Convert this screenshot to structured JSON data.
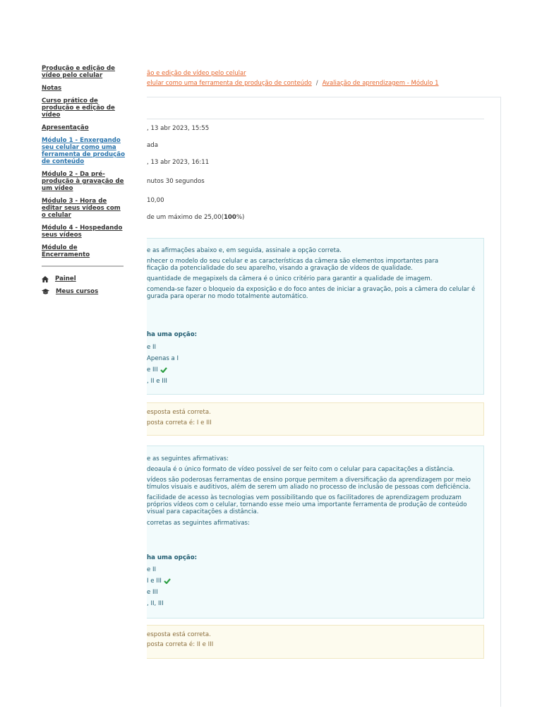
{
  "sidebar": {
    "items": [
      {
        "label": "Produção e edição de vídeo pelo celular",
        "active": false
      },
      {
        "label": "Notas",
        "active": false
      },
      {
        "label": "Curso prático de produção e edição de vídeo",
        "active": false
      },
      {
        "label": "Apresentação",
        "active": false
      },
      {
        "label": "Módulo 1 - Enxergando seu celular como uma ferramenta de produção de conteúdo",
        "active": true
      },
      {
        "label": "Módulo 2 - Da pré-produção à gravação de um vídeo",
        "active": false
      },
      {
        "label": "Módulo 3 - Hora de editar seus vídeos com o celular",
        "active": false
      },
      {
        "label": "Módulo 4 - Hospedando seus vídeos",
        "active": false
      },
      {
        "label": "Módulo de Encerramento",
        "active": false
      }
    ],
    "painel": "Painel",
    "meus_cursos": "Meus cursos"
  },
  "breadcrumb": {
    "line1": "ão e edição de vídeo pelo celular",
    "line2a": "elular como uma ferramenta de produção de conteúdo",
    "separator": "/",
    "line2b": "Avaliação de aprendizagem - Módulo 1"
  },
  "summary": {
    "started": ", 13 abr 2023, 15:55",
    "state": "ada",
    "completed": ", 13 abr 2023, 16:11",
    "time": "nutos 30 segundos",
    "marks": "10,00",
    "grade_prefix": "de um máximo de 25,00(",
    "grade_bold": "100",
    "grade_suffix": "%)"
  },
  "q1": {
    "intro": "e as afirmações abaixo e, em seguida, assinale a opção correta.",
    "s1a": "nhecer o modelo do seu celular e as características da câmera são elementos importantes para",
    "s1b": "ficação da potencialidade do seu aparelho, visando a gravação de vídeos de qualidade.",
    "s2": "quantidade de megapixels da câmera é o único critério para garantir a qualidade de imagem.",
    "s3a": "comenda-se fazer o bloqueio da exposição e do foco antes de iniciar a gravação, pois a câmera do celular é",
    "s3b": "gurada para operar no modo totalmente automático.",
    "prompt": "ha uma opção:",
    "options": [
      "e II",
      "Apenas a I",
      "e III",
      ", II e III"
    ],
    "feedback1": "esposta está correta.",
    "feedback2": "posta correta é: I e III"
  },
  "q2": {
    "intro": "e as seguintes afirmativas:",
    "s1": "deoaula é o único formato de vídeo possível de ser feito com o celular para capacitações a distância.",
    "s2a": "vídeos são poderosas ferramentas de ensino porque permitem a diversificação da aprendizagem por meio",
    "s2b": "tímulos visuais e auditivos, além de serem um aliado no processo de inclusão de pessoas com deficiência.",
    "s3a": "facilidade de acesso às tecnologias vem possibilitando que os facilitadores de aprendizagem produzam",
    "s3b": "próprios vídeos com o celular, tornando esse meio uma importante ferramenta de produção de conteúdo",
    "s3c": "visual para capacitações a distância.",
    "s4": " corretas as seguintes afirmativas:",
    "prompt": "ha uma opção:",
    "options": [
      "e II",
      "I e III",
      "e III",
      ", II, III"
    ],
    "feedback1": "esposta está correta.",
    "feedback2": "posta correta é: II e III"
  },
  "colors": {
    "accent_link": "#e5652d",
    "question_text": "#1e5a6f",
    "correct": "#2e9f44",
    "feedback": "#8a6d3b"
  }
}
